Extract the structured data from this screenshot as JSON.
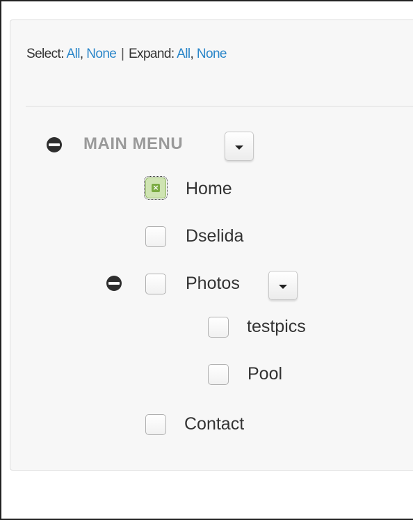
{
  "toolbar": {
    "select_label": "Select:",
    "select_all": "All",
    "select_comma": ",",
    "select_none": "None",
    "separator": "|",
    "expand_label": "Expand:",
    "expand_all": "All",
    "expand_comma": ",",
    "expand_none": "None"
  },
  "menu": {
    "title": "MAIN MENU",
    "expanded": true,
    "items": [
      {
        "label": "Home",
        "checked": true
      },
      {
        "label": "Dselida",
        "checked": false
      },
      {
        "label": "Photos",
        "checked": false,
        "expanded": true,
        "children": [
          {
            "label": "testpics",
            "checked": false
          },
          {
            "label": "Pool",
            "checked": false
          }
        ]
      },
      {
        "label": "Contact",
        "checked": false
      }
    ]
  },
  "colors": {
    "link": "#2a86c9",
    "title": "#9a9a9a",
    "checked_fill": "#cfe4b2",
    "checked_mark": "#7bab42"
  },
  "icons": {
    "collapse": "minus-circle-icon",
    "dropdown": "caret-down-icon",
    "checked": "x-mark-icon"
  }
}
